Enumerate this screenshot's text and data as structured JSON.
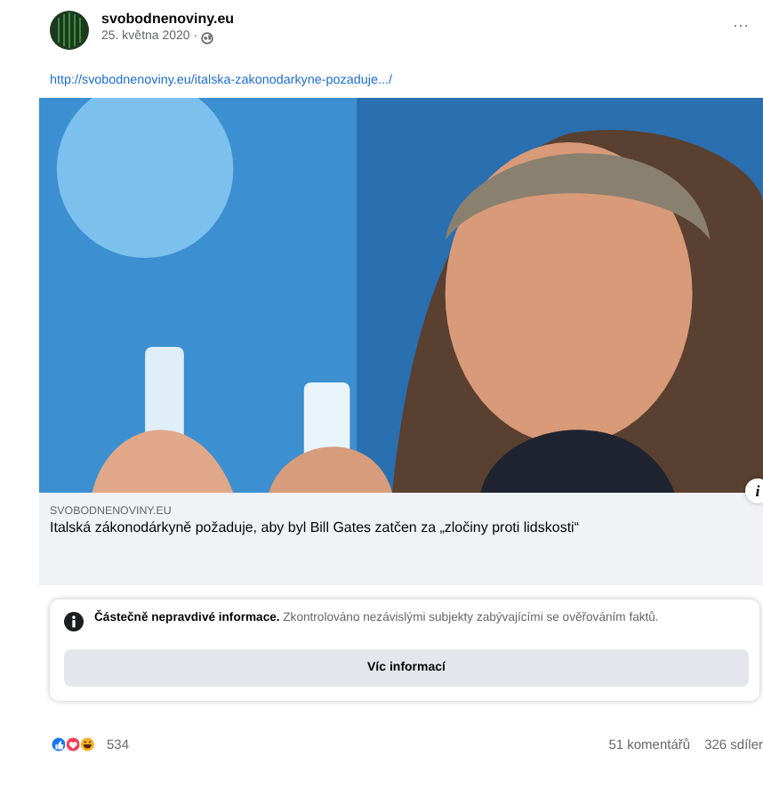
{
  "post": {
    "author": "svobodnenoviny.eu",
    "date": "25. května 2020 ·",
    "more": "···",
    "link": "http://svobodnenoviny.eu/italska-zakonodarkyne-pozaduje.../"
  },
  "preview": {
    "info": "i",
    "domain": "SVOBODNENOVINY.EU",
    "title": "Italská zákonodárkyně požaduje, aby byl Bill Gates zatčen za „zločiny proti lidskosti“"
  },
  "fact_check": {
    "text": "**Částečně nepravdivé informace.** Zkontrolováno nezávislými subjekty zabývajícími se ověřováním faktů.",
    "button": "Víc informací"
  },
  "footer": {
    "reactions_count": "534",
    "comments": "51 komentářů",
    "shares": "326 sdíler"
  }
}
